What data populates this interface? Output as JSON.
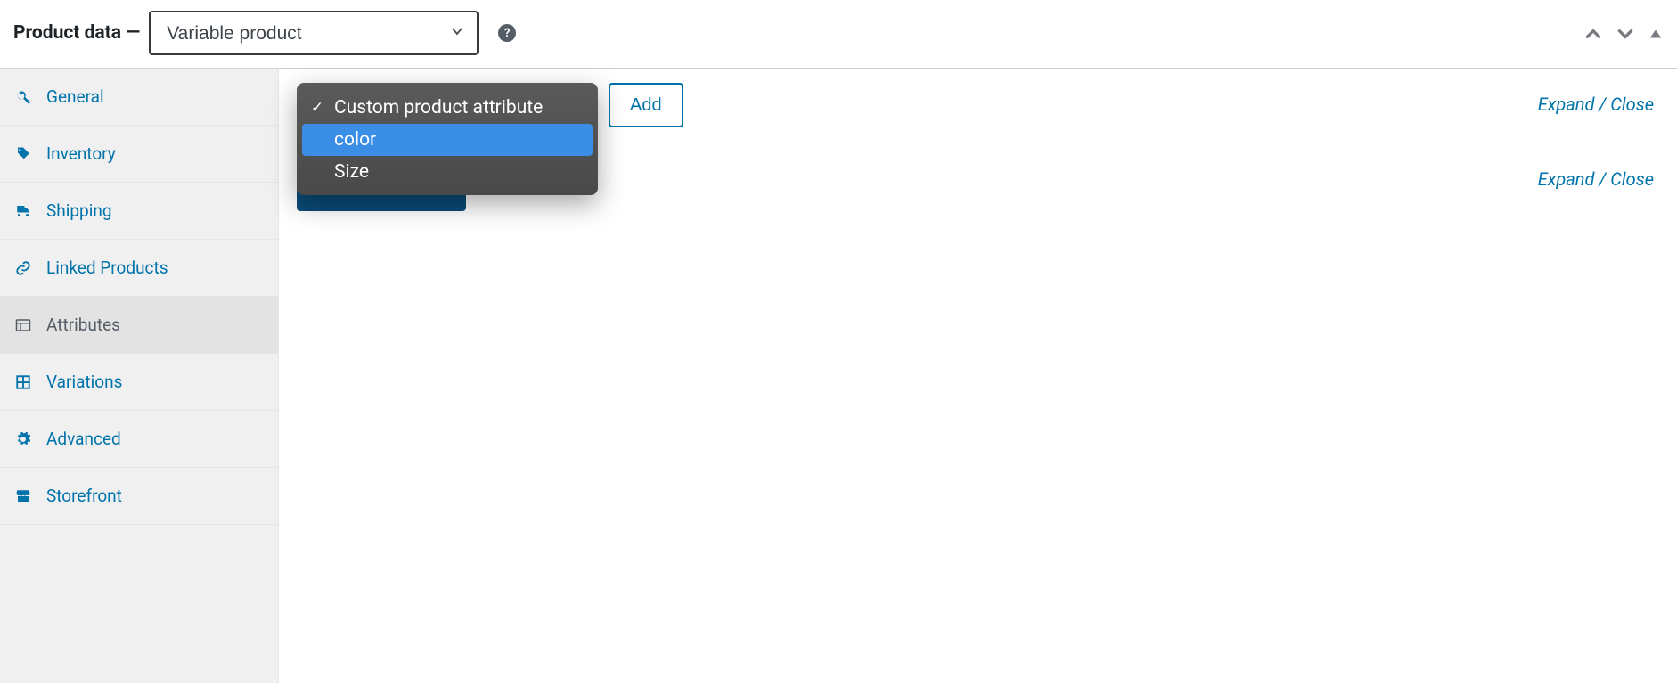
{
  "header": {
    "title": "Product data —",
    "product_type": "Variable product",
    "help_text": "?"
  },
  "sidebar": {
    "tabs": [
      {
        "label": "General",
        "icon": "wrench"
      },
      {
        "label": "Inventory",
        "icon": "tag"
      },
      {
        "label": "Shipping",
        "icon": "truck"
      },
      {
        "label": "Linked Products",
        "icon": "link"
      },
      {
        "label": "Attributes",
        "icon": "list",
        "active": true
      },
      {
        "label": "Variations",
        "icon": "grid"
      },
      {
        "label": "Advanced",
        "icon": "gear"
      },
      {
        "label": "Storefront",
        "icon": "store"
      }
    ]
  },
  "content": {
    "dropdown": {
      "options": [
        {
          "label": "Custom product attribute",
          "selected": true
        },
        {
          "label": "color",
          "highlight": true
        },
        {
          "label": "Size"
        }
      ]
    },
    "add_button": "Add",
    "expand_label": "Expand",
    "close_label": "Close",
    "separator": " / "
  }
}
